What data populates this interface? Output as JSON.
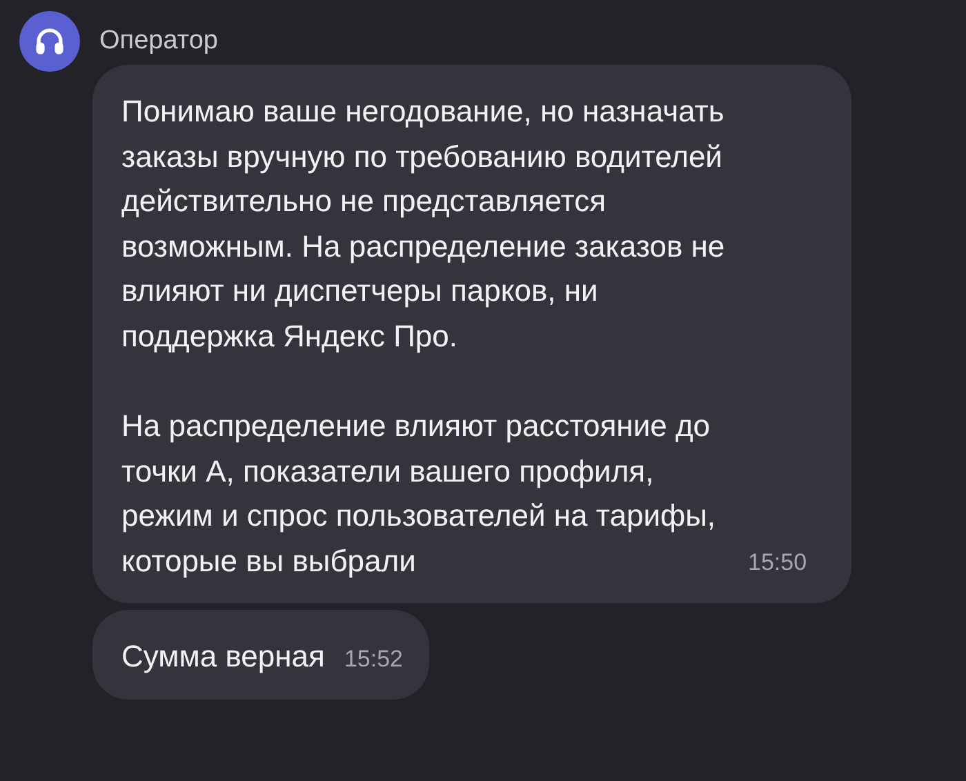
{
  "sender": {
    "name": "Оператор"
  },
  "messages": [
    {
      "paragraphs": [
        "Понимаю ваше негодование, но назначать заказы вручную по требованию водителей действительно не представляется возможным. На распределение заказов не влияют ни диспетчеры парков, ни поддержка Яндекс Про.",
        "На распределение влияют расстояние до точки А, показатели вашего профиля, режим и спрос пользователей на тарифы, которые вы выбрали"
      ],
      "time": "15:50"
    },
    {
      "paragraphs": [
        "Сумма верная"
      ],
      "time": "15:52"
    }
  ]
}
